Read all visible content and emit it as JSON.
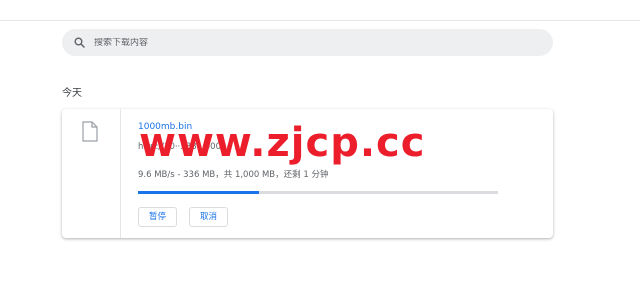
{
  "search": {
    "placeholder": "搜索下载内容",
    "icon": "search-icon"
  },
  "date_header": "今天",
  "download": {
    "filename": "1000mb.bin",
    "url": "http://10··:·38···0003·· n",
    "status": "9.6 MB/s - 336 MB，共 1,000 MB，还剩 1 分钟",
    "progress": 0.336,
    "icon": "file-icon",
    "pause_label": "暂停",
    "cancel_label": "取消"
  },
  "watermark": "www.zjcp.cc",
  "colors": {
    "accent": "#1a73e8",
    "watermark": "#ec1e2c",
    "search_bg": "#eeeff1",
    "progress_track": "#dadce0"
  }
}
